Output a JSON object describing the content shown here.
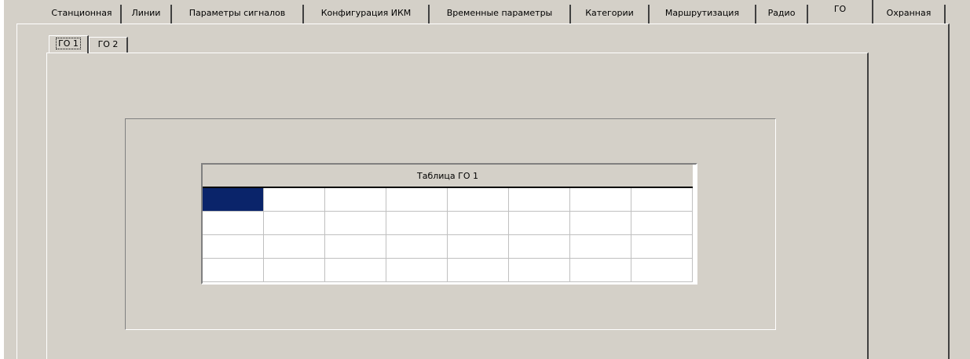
{
  "main_tabs": [
    {
      "label": "Станционная"
    },
    {
      "label": "Линии"
    },
    {
      "label": "Параметры сигналов"
    },
    {
      "label": "Конфигурация ИКМ"
    },
    {
      "label": "Временные параметры"
    },
    {
      "label": "Категории"
    },
    {
      "label": "Маршрутизация"
    },
    {
      "label": "Радио"
    },
    {
      "label": "ГО",
      "active": true
    },
    {
      "label": "Охранная"
    }
  ],
  "sub_tabs": [
    {
      "label": "ГО 1",
      "active": true
    },
    {
      "label": "ГО 2"
    }
  ],
  "grid": {
    "title": "Таблица ГО 1",
    "columns": 8,
    "rows": 4,
    "selected_cell": [
      0,
      0
    ]
  },
  "colors": {
    "face": "#d4d0c8",
    "selection": "#0a246a"
  }
}
